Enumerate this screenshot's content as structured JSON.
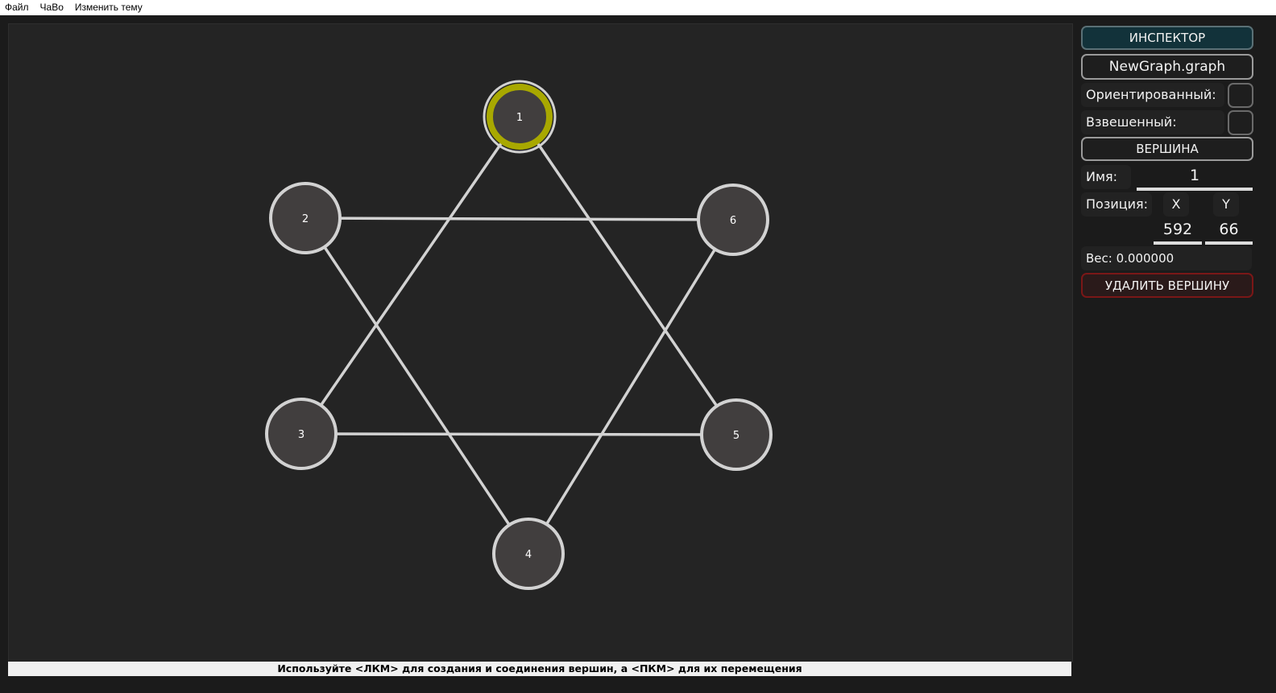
{
  "menu": {
    "items": [
      "Файл",
      "ЧаВо",
      "Изменить тему"
    ]
  },
  "graph": {
    "selected": "1",
    "vertices": [
      {
        "name": "1"
      },
      {
        "name": "2"
      },
      {
        "name": "3"
      },
      {
        "name": "4"
      },
      {
        "name": "5"
      },
      {
        "name": "6"
      }
    ],
    "edges": [
      [
        "1",
        "3"
      ],
      [
        "1",
        "5"
      ],
      [
        "2",
        "6"
      ],
      [
        "2",
        "4"
      ],
      [
        "3",
        "5"
      ],
      [
        "6",
        "4"
      ]
    ]
  },
  "colors": {
    "canvas_bg": "#242424",
    "vertex_fill": "#413e3e",
    "vertex_stroke": "#d2d2d2",
    "selected_stroke": "#a8a800",
    "edge": "#d2d2d2",
    "inspector_header_bg": "#12323a",
    "delete_border": "#7a1717"
  },
  "status": {
    "hint": "Используйте <ЛКМ> для создания и соединения вершин, а <ПКМ> для их перемещения"
  },
  "inspector": {
    "title": "ИНСПЕКТОР",
    "file_name": "NewGraph.graph",
    "directed_label": "Ориентированный:",
    "weighted_label": "Взвешенный:",
    "directed_checked": false,
    "weighted_checked": false,
    "vertex_section": "ВЕРШИНА",
    "name_label": "Имя:",
    "name_value": "1",
    "position_label": "Позиция:",
    "x_label": "X",
    "y_label": "Y",
    "x_value": "592",
    "y_value": "66",
    "weight_text": "Вес: 0.000000",
    "delete_button": "УДАЛИТЬ ВЕРШИНУ"
  }
}
